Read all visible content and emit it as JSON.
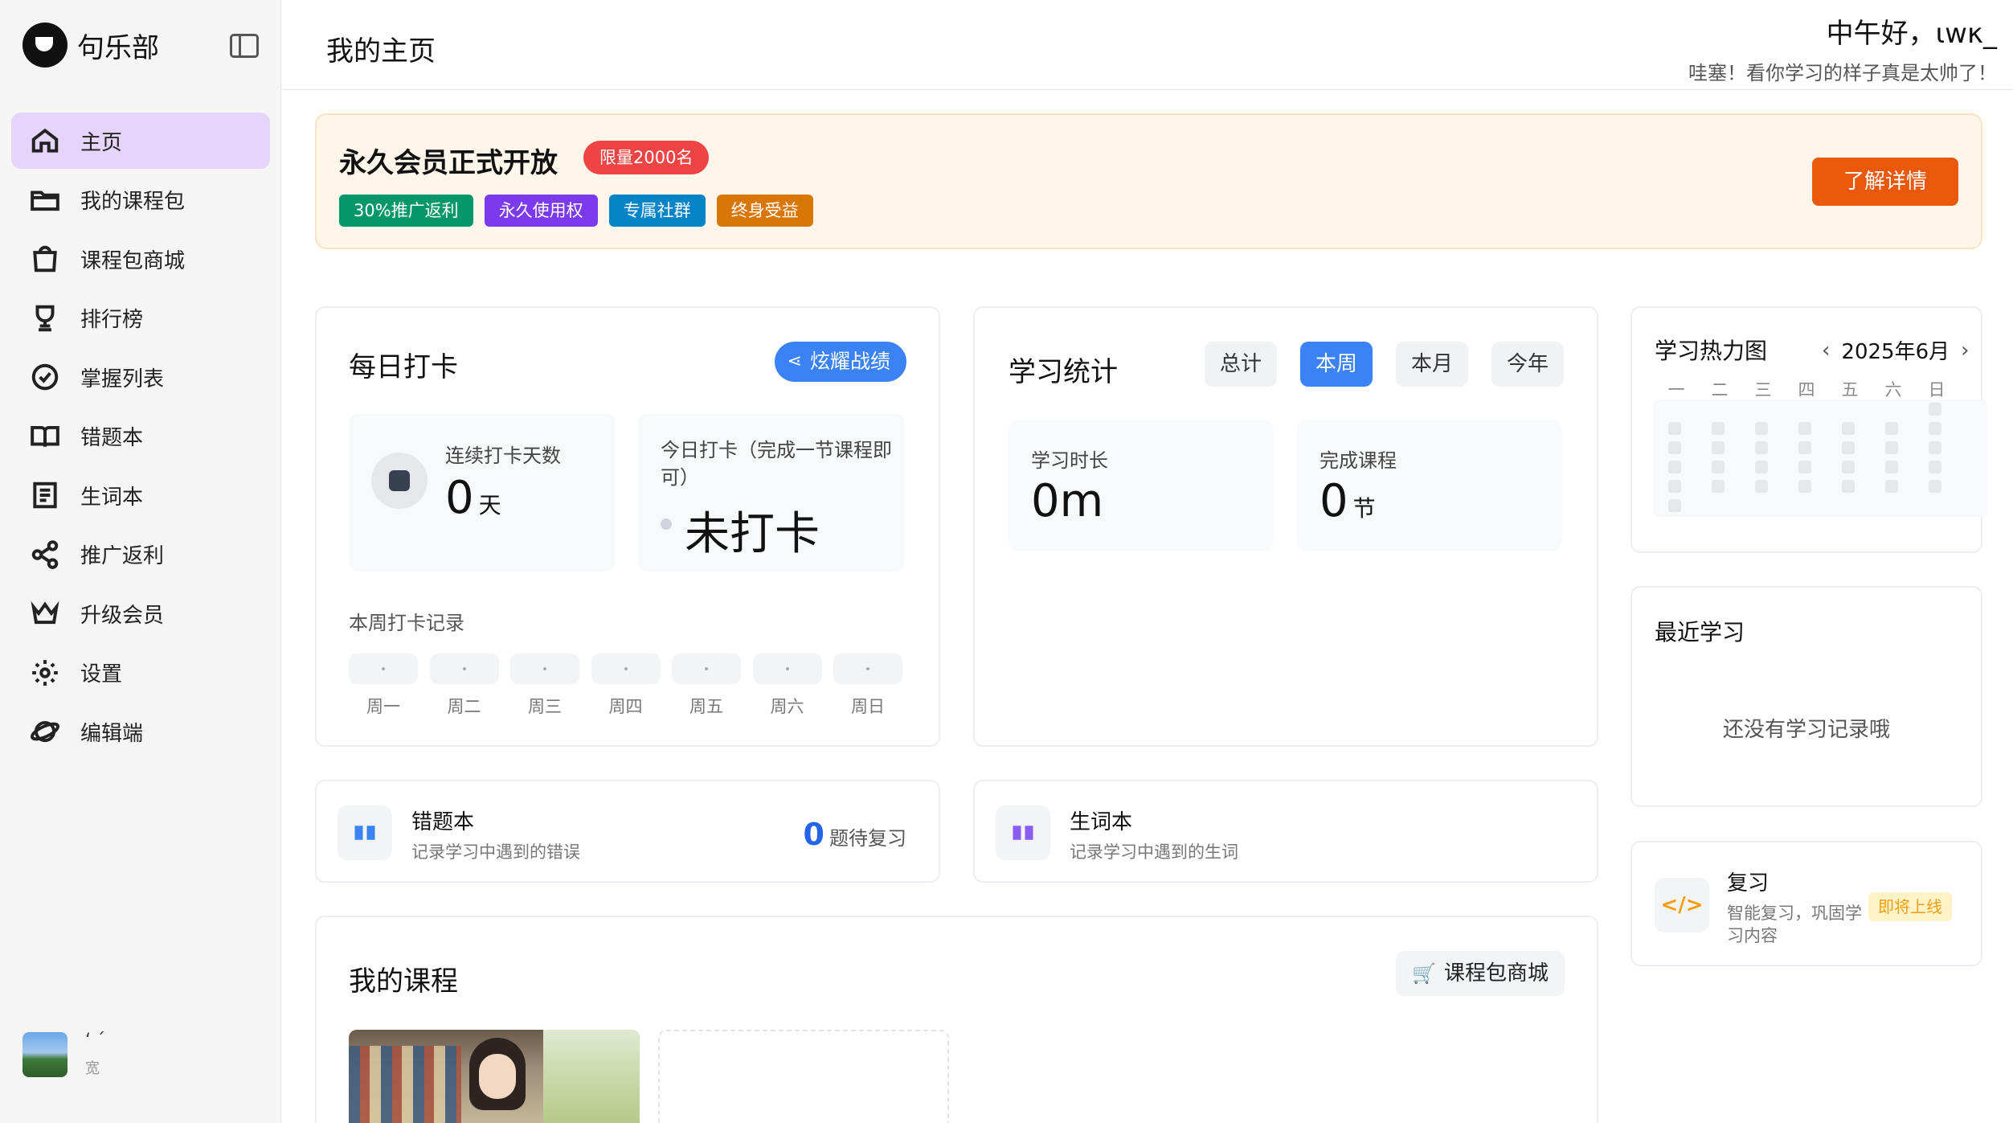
{
  "app": {
    "name": "句乐部"
  },
  "sidebar": {
    "items": [
      {
        "label": "主页",
        "icon": "home-icon",
        "active": true
      },
      {
        "label": "我的课程包",
        "icon": "folder-icon"
      },
      {
        "label": "课程包商城",
        "icon": "shopping-bag-icon"
      },
      {
        "label": "排行榜",
        "icon": "trophy-icon"
      },
      {
        "label": "掌握列表",
        "icon": "check-circle-icon"
      },
      {
        "label": "错题本",
        "icon": "book-open-icon"
      },
      {
        "label": "生词本",
        "icon": "notebook-icon"
      },
      {
        "label": "推广返利",
        "icon": "share-icon"
      },
      {
        "label": "升级会员",
        "icon": "crown-icon"
      },
      {
        "label": "设置",
        "icon": "gear-icon"
      },
      {
        "label": "编辑端",
        "icon": "planet-icon"
      }
    ],
    "user": {
      "name": "‘           ˊ",
      "sub": "宽"
    }
  },
  "header": {
    "title": "我的主页",
    "greeting": "中午好，ιwκ_",
    "subtitle": "哇塞！看你学习的样子真是太帅了！"
  },
  "promo": {
    "title": "永久会员正式开放",
    "limit_badge": "限量2000名",
    "tags": [
      {
        "label": "30%推广返利",
        "color": "#059669"
      },
      {
        "label": "永久使用权",
        "color": "#7c3aed"
      },
      {
        "label": "专属社群",
        "color": "#0284c7"
      },
      {
        "label": "终身受益",
        "color": "#d97706"
      }
    ],
    "cta": "了解详情"
  },
  "checkin": {
    "title": "每日打卡",
    "share_label": "炫耀战绩",
    "streak_label": "连续打卡天数",
    "streak_value": "0",
    "streak_unit": "天",
    "today_label": "今日打卡（完成一节课程即可）",
    "today_status": "未打卡",
    "week_label": "本周打卡记录",
    "week_days": [
      "周一",
      "周二",
      "周三",
      "周四",
      "周五",
      "周六",
      "周日"
    ]
  },
  "stats": {
    "title": "学习统计",
    "tabs": [
      "总计",
      "本周",
      "本月",
      "今年"
    ],
    "active_tab": "本周",
    "duration_label": "学习时长",
    "duration_value": "0m",
    "courses_label": "完成课程",
    "courses_value": "0",
    "courses_unit": "节"
  },
  "heatmap": {
    "title": "学习热力图",
    "month": "2025年6月",
    "weekdays": [
      "一",
      "二",
      "三",
      "四",
      "五",
      "六",
      "日"
    ]
  },
  "recent": {
    "title": "最近学习",
    "empty": "还没有学习记录哦"
  },
  "mistakes": {
    "title": "错题本",
    "desc": "记录学习中遇到的错误",
    "count": "0",
    "count_label": "题待复习"
  },
  "vocab": {
    "title": "生词本",
    "desc": "记录学习中遇到的生词"
  },
  "review": {
    "title": "复习",
    "desc_line1": "智能复习，巩固学",
    "desc_line2": "习内容",
    "badge": "即将上线"
  },
  "courses": {
    "title": "我的课程",
    "shop_label": "课程包商城"
  }
}
